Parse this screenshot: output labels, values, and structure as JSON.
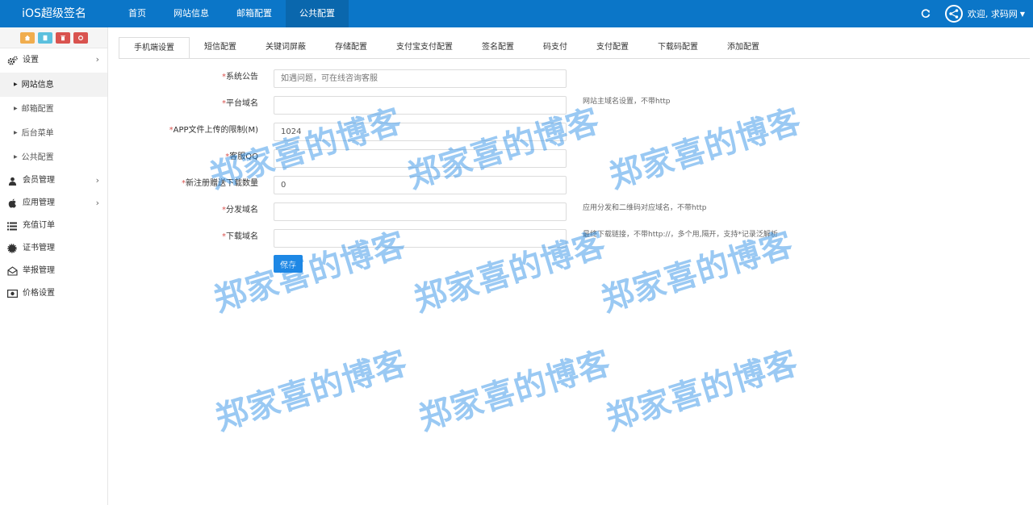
{
  "app": {
    "title": "iOS超级签名"
  },
  "topnav": [
    {
      "label": "首页"
    },
    {
      "label": "网站信息"
    },
    {
      "label": "邮箱配置"
    },
    {
      "label": "公共配置"
    }
  ],
  "user": {
    "welcome": "欢迎, 求码网"
  },
  "sidebar": {
    "settings_label": "设置",
    "settings_sub": [
      {
        "label": "网站信息"
      },
      {
        "label": "邮箱配置"
      },
      {
        "label": "后台菜单"
      },
      {
        "label": "公共配置"
      }
    ],
    "menu": [
      {
        "label": "会员管理"
      },
      {
        "label": "应用管理"
      },
      {
        "label": "充值订单"
      },
      {
        "label": "证书管理"
      },
      {
        "label": "举报管理"
      },
      {
        "label": "价格设置"
      }
    ]
  },
  "tabs": [
    {
      "label": "手机端设置"
    },
    {
      "label": "短信配置"
    },
    {
      "label": "关键词屏蔽"
    },
    {
      "label": "存储配置"
    },
    {
      "label": "支付宝支付配置"
    },
    {
      "label": "签名配置"
    },
    {
      "label": "码支付"
    },
    {
      "label": "支付配置"
    },
    {
      "label": "下载码配置"
    },
    {
      "label": "添加配置"
    }
  ],
  "form": {
    "required_mark": "*",
    "fields": [
      {
        "label": "系统公告",
        "value": "",
        "placeholder": "如遇问题，可在线咨询客服",
        "hint": ""
      },
      {
        "label": "平台域名",
        "value": "",
        "placeholder": "",
        "hint": "网站主域名设置，不带http"
      },
      {
        "label": "APP文件上传的限制(M)",
        "value": "1024",
        "placeholder": "",
        "hint": ""
      },
      {
        "label": "客服QQ",
        "value": "",
        "placeholder": "",
        "hint": ""
      },
      {
        "label": "新注册赠送下载数量",
        "value": "0",
        "placeholder": "",
        "hint": ""
      },
      {
        "label": "分发域名",
        "value": "",
        "placeholder": "",
        "hint": "应用分发和二维码对应域名，不带http"
      },
      {
        "label": "下载域名",
        "value": "",
        "placeholder": "",
        "hint": "最终下载链接，不带http://，多个用,隔开，支持*记录泛解析"
      }
    ],
    "save_label": "保存"
  },
  "watermark": {
    "text": "郑家喜的博客"
  },
  "colors": {
    "topbar": "#0b76c8",
    "primary_button": "#1e88e5",
    "watermark": "#1e88e5",
    "required": "#d9534f"
  }
}
